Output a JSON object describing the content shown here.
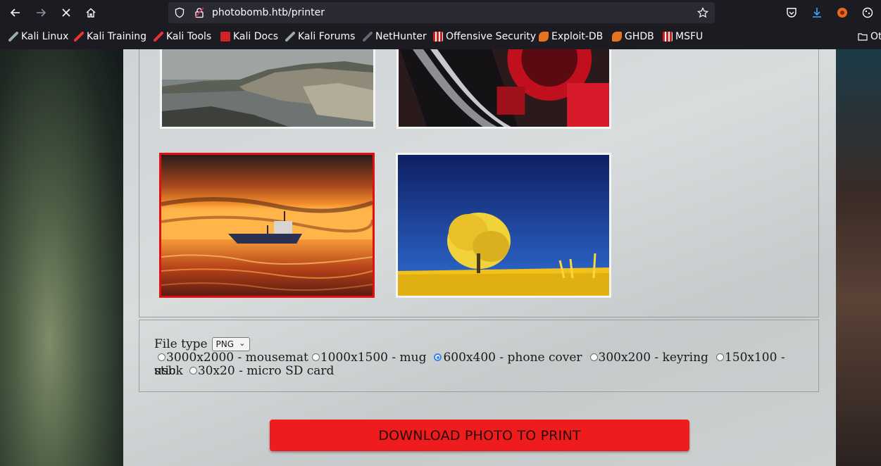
{
  "browser": {
    "url": "photobomb.htb/printer",
    "bookmarks": [
      {
        "label": "Kali Linux",
        "icon": "kali-dragon-icon"
      },
      {
        "label": "Kali Training",
        "icon": "kali-dragon-icon"
      },
      {
        "label": "Kali Tools",
        "icon": "kali-dragon-icon"
      },
      {
        "label": "Kali Docs",
        "icon": "kali-docs-icon"
      },
      {
        "label": "Kali Forums",
        "icon": "kali-dragon-icon"
      },
      {
        "label": "NetHunter",
        "icon": "nethunter-icon"
      },
      {
        "label": "Offensive Security",
        "icon": "offsec-icon"
      },
      {
        "label": "Exploit-DB",
        "icon": "exploitdb-icon"
      },
      {
        "label": "GHDB",
        "icon": "exploitdb-icon"
      },
      {
        "label": "MSFU",
        "icon": "offsec-icon"
      },
      {
        "label": "Ot",
        "icon": "folder-icon"
      }
    ]
  },
  "gallery": {
    "photos": [
      {
        "name": "coastline-photo",
        "selected": false
      },
      {
        "name": "red-car-wheel-photo",
        "selected": false
      },
      {
        "name": "boat-sunset-photo",
        "selected": true
      },
      {
        "name": "yellow-tree-photo",
        "selected": false
      }
    ]
  },
  "options": {
    "file_type_label": "File type",
    "file_type_value": "PNG",
    "sizes": [
      {
        "label": "3000x2000 - mousemat",
        "checked": false
      },
      {
        "label": "1000x1500 - mug",
        "checked": false
      },
      {
        "label": "600x400 - phone cover",
        "checked": true
      },
      {
        "label": "300x200 - keyring",
        "checked": false
      },
      {
        "label": "150x100 - usb",
        "checked": false
      },
      {
        "label": "stick",
        "checked": false
      },
      {
        "label": "30x20 - micro SD card",
        "checked": false
      }
    ]
  },
  "download_button": "DOWNLOAD PHOTO TO PRINT",
  "colors": {
    "accent_red": "#ee1c1c",
    "selected_border": "#e01010",
    "radio_checked": "#3a86e8"
  }
}
